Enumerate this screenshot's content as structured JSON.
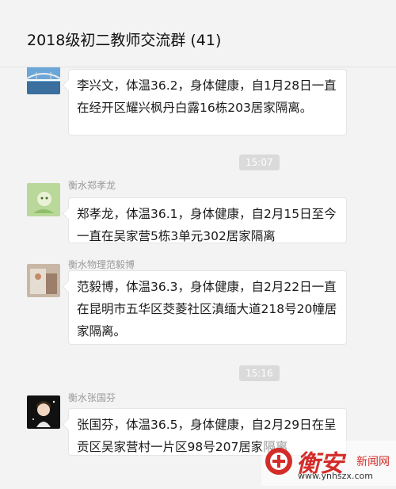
{
  "header": {
    "title": "2018级初二教师交流群 (41)"
  },
  "messages": [
    {
      "sender": "",
      "text": "李兴文，体温36.2，身体健康，自1月28日一直在经开区耀兴枫丹白露16栋203居家隔离。"
    },
    {
      "time": "15:07"
    },
    {
      "sender": "衡水郑孝龙",
      "text": "郑孝龙，体温36.1，身体健康，自2月15日至今一直在吴家营5栋3单元302居家隔离"
    },
    {
      "sender": "衡水物理范毅博",
      "text": "范毅博，体温36.3，身体健康，自2月22日一直在昆明市五华区茭菱社区滇缅大道218号20幢居家隔离。"
    },
    {
      "time": "15:16"
    },
    {
      "sender": "衡水张国芬",
      "text": "张国芬，体温36.5，身体健康，自2月29日在呈贡区吴家营村一片区98号207居家隔离"
    }
  ],
  "watermark": {
    "brand": "衡安",
    "site_name": "新闻网",
    "url": "www.ynhszx.com"
  }
}
